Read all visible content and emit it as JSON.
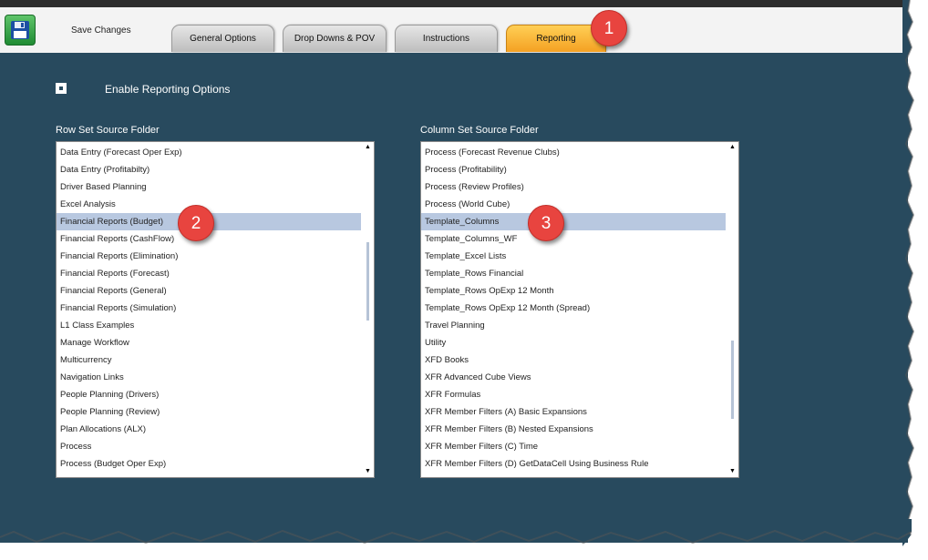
{
  "toolbar": {
    "save_icon": "floppy-disk-icon",
    "save_label": "Save Changes",
    "tabs": [
      {
        "label": "General Options",
        "active": false
      },
      {
        "label": "Drop Downs & POV",
        "active": false
      },
      {
        "label": "Instructions",
        "active": false
      },
      {
        "label": "Reporting",
        "active": true
      }
    ]
  },
  "callouts": [
    "1",
    "2",
    "3"
  ],
  "options": {
    "enable_reporting_label": "Enable Reporting Options"
  },
  "row_set": {
    "label": "Row Set Source Folder",
    "items": [
      "Data Entry (Forecast Oper Exp)",
      "Data Entry (Profitabilty)",
      "Driver Based Planning",
      "Excel Analysis",
      "Financial Reports (Budget)",
      "Financial Reports (CashFlow)",
      "Financial Reports (Elimination)",
      "Financial Reports (Forecast)",
      "Financial Reports (General)",
      "Financial Reports (Simulation)",
      "L1 Class Examples",
      "Manage Workflow",
      "Multicurrency",
      "Navigation Links",
      "People Planning (Drivers)",
      "People Planning (Review)",
      "Plan Allocations (ALX)",
      "Process",
      "Process (Budget Oper Exp)"
    ],
    "selected": "Financial Reports (Budget)"
  },
  "column_set": {
    "label": "Column Set Source Folder",
    "items": [
      "Process (Forecast Revenue Clubs)",
      "Process (Profitability)",
      "Process (Review Profiles)",
      "Process (World Cube)",
      "Template_Columns",
      "Template_Columns_WF",
      "Template_Excel Lists",
      "Template_Rows Financial",
      "Template_Rows OpExp 12 Month",
      "Template_Rows OpExp 12 Month (Spread)",
      "Travel Planning",
      "Utility",
      "XFD Books",
      "XFR Advanced Cube Views",
      "XFR Formulas",
      "XFR Member Filters (A) Basic Expansions",
      "XFR Member Filters (B) Nested Expansions",
      "XFR Member Filters (C) Time",
      "XFR Member Filters (D) GetDataCell Using Business Rule"
    ],
    "selected": "Template_Columns"
  },
  "colors": {
    "panel_bg": "#284a5e",
    "active_tab": "#f4a123",
    "callout": "#e8443f",
    "selection": "#b8c8e0"
  }
}
